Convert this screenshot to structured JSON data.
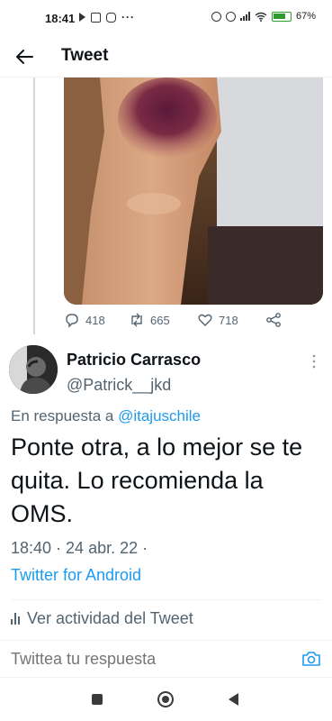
{
  "status_bar": {
    "time": "18:41",
    "battery": "67"
  },
  "header": {
    "title": "Tweet"
  },
  "parent_tweet": {
    "replies": "418",
    "retweets": "665",
    "likes": "718"
  },
  "tweet": {
    "author_name": "Patricio Carrasco",
    "author_handle": "@Patrick__jkd",
    "reply_prefix": "En respuesta a",
    "reply_mention": "@itajuschile",
    "text": "Ponte otra, a lo mejor se te quita. Lo recomienda la OMS.",
    "timestamp": "18:40 · 24 abr. 22 ·",
    "source": "Twitter for Android"
  },
  "activity": {
    "label": "Ver actividad del Tweet"
  },
  "reply_bar": {
    "placeholder": "Twittea tu respuesta"
  },
  "colors": {
    "accent": "#1d9bf0",
    "text": "#0f1419",
    "secondary": "#536471"
  }
}
